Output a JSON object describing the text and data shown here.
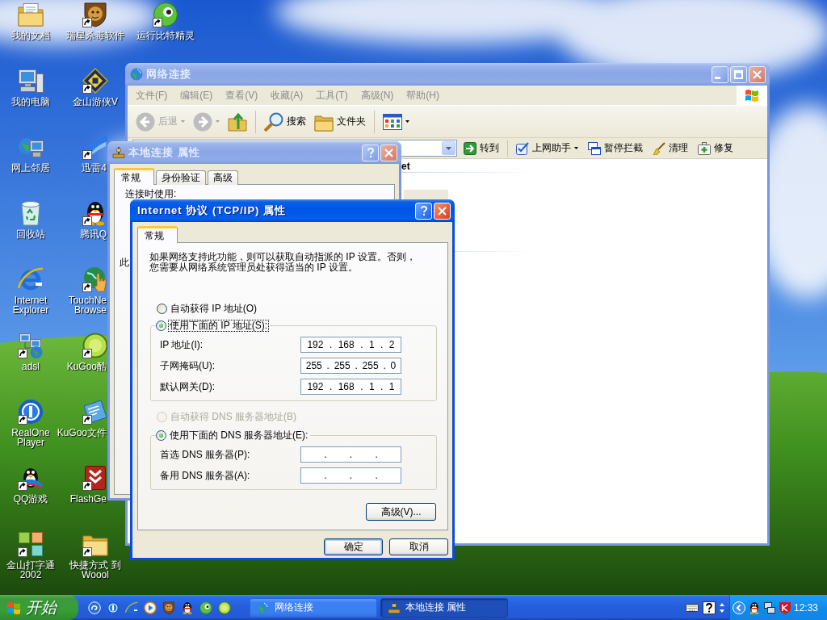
{
  "desktop": {
    "icons": [
      {
        "label": "我的文档",
        "shortcut": false
      },
      {
        "label": "我的电脑",
        "shortcut": false
      },
      {
        "label": "网上邻居",
        "shortcut": false
      },
      {
        "label": "回收站",
        "shortcut": false
      },
      {
        "label": "Internet Explorer",
        "shortcut": false
      },
      {
        "label": "adsl",
        "shortcut": true
      },
      {
        "label": "RealOne Player",
        "shortcut": true
      },
      {
        "label": "QQ游戏",
        "shortcut": true
      },
      {
        "label": "金山打字通 2002",
        "shortcut": true
      },
      {
        "label": "瑞星杀毒软件",
        "shortcut": true
      },
      {
        "label": "金山游侠V",
        "shortcut": true
      },
      {
        "label": "迅雷4",
        "shortcut": true
      },
      {
        "label": "腾讯Q",
        "shortcut": true
      },
      {
        "label": "TouchNe Browse",
        "shortcut": true
      },
      {
        "label": "KuGoo酷",
        "shortcut": true
      },
      {
        "label": "KuGoo文件",
        "shortcut": true
      },
      {
        "label": "FlashGe",
        "shortcut": true
      },
      {
        "label": "快捷方式 到 Woool",
        "shortcut": true
      },
      {
        "label": "运行比特精灵",
        "shortcut": true
      }
    ]
  },
  "explorer": {
    "title": "网络连接",
    "active": false,
    "menu": [
      "文件(F)",
      "编辑(E)",
      "查看(V)",
      "收藏(A)",
      "工具(T)",
      "高级(N)",
      "帮助(H)"
    ],
    "toolbar": [
      {
        "kind": "back",
        "label": "后退",
        "disabled": true,
        "dropdown": true
      },
      {
        "kind": "forward",
        "disabled": true,
        "dropdown": true
      },
      {
        "kind": "up",
        "disabled": false,
        "dropdown": false
      },
      {
        "kind": "search",
        "label": "搜索",
        "disabled": false,
        "dropdown": false
      },
      {
        "kind": "folders",
        "label": "文件夹",
        "disabled": false,
        "dropdown": false
      },
      {
        "kind": "views",
        "disabled": false,
        "dropdown": true
      }
    ],
    "links": [
      {
        "label": "转到",
        "dropdown": false
      },
      {
        "label": "上网助手",
        "dropdown": true
      },
      {
        "label": "暂停拦截",
        "dropdown": false
      },
      {
        "label": "清理",
        "dropdown": false
      },
      {
        "label": "修复",
        "dropdown": false
      }
    ],
    "group_header": "et"
  },
  "connection_dialog": {
    "title": "本地连接 属性",
    "active": false,
    "tabs": [
      {
        "label": "常规",
        "selected": true
      },
      {
        "label": "身份验证",
        "selected": false
      },
      {
        "label": "高级",
        "selected": false
      }
    ],
    "connect_label": "连接时使用:",
    "items_label": "此"
  },
  "tcpip_dialog": {
    "title": "Internet 协议 (TCP/IP) 属性",
    "active": true,
    "tabs": [
      {
        "label": "常规",
        "selected": true
      }
    ],
    "description": "如果网络支持此功能，则可以获取自动指派的 IP 设置。否则，您需要从网络系统管理员处获得适当的 IP 设置。",
    "ip_options": [
      {
        "label": "自动获得 IP 地址(O)",
        "selected": false,
        "hovered": true,
        "focused": false,
        "disabled": false
      },
      {
        "label": "使用下面的 IP 地址(S):",
        "selected": true,
        "hovered": false,
        "focused": true,
        "disabled": false
      }
    ],
    "ip_fields": [
      {
        "label": "IP 地址(I):",
        "value": "192 . 168 . 1 . 2"
      },
      {
        "label": "子网掩码(U):",
        "value": "255 . 255 . 255 . 0"
      },
      {
        "label": "默认网关(D):",
        "value": "192 . 168 . 1 . 1"
      }
    ],
    "dns_options": [
      {
        "label": "自动获得 DNS 服务器地址(B)",
        "selected": false,
        "hovered": false,
        "focused": false,
        "disabled": true
      },
      {
        "label": "使用下面的 DNS 服务器地址(E):",
        "selected": true,
        "hovered": false,
        "focused": false,
        "disabled": false
      }
    ],
    "dns_fields": [
      {
        "label": "首选 DNS 服务器(P):",
        "value": ". . ."
      },
      {
        "label": "备用 DNS 服务器(A):",
        "value": ". . ."
      }
    ],
    "advanced_button": "高级(V)...",
    "buttons": [
      {
        "label": "确定",
        "default": true
      },
      {
        "label": "取消",
        "default": false
      }
    ]
  },
  "taskbar": {
    "start": "开始",
    "tasks": [
      {
        "label": "网络连接",
        "selected": false
      },
      {
        "label": "本地连接 属性",
        "selected": true
      }
    ],
    "clock": "12:33"
  }
}
